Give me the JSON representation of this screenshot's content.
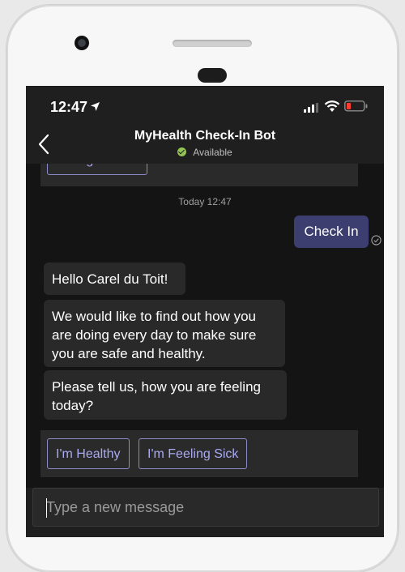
{
  "status_bar": {
    "time": "12:47"
  },
  "header": {
    "title": "MyHealth Check-In Bot",
    "status": "Available"
  },
  "chat": {
    "previous_card_button": "Recognise Me",
    "timestamp": "Today 12:47",
    "sent_message": "Check In",
    "bot_messages": [
      "Hello Carel du Toit!",
      "We would like to find out how you are doing every day to make sure you are safe and healthy.",
      "Please tell us, how you are feeling today?"
    ],
    "actions": [
      "I'm Healthy",
      "I'm Feeling Sick"
    ]
  },
  "compose": {
    "placeholder": "Type a new message"
  },
  "colors": {
    "accent": "#a9aaf2",
    "sent_bubble": "#3b3e6e",
    "available": "#92c353"
  }
}
